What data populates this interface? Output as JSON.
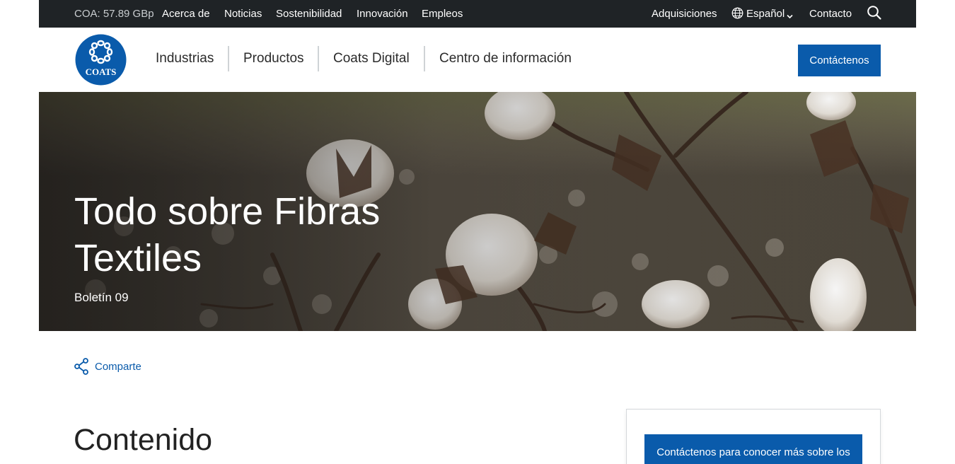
{
  "topbar": {
    "ticker": "COA: 57.89 GBp",
    "links": [
      "Acerca de",
      "Noticias",
      "Sostenibilidad",
      "Innovación",
      "Empleos"
    ],
    "right": {
      "acquisitions": "Adquisiciones",
      "language": "Español",
      "contact": "Contacto"
    }
  },
  "logo": {
    "text": "COATS"
  },
  "nav": {
    "items": [
      "Industrias",
      "Productos",
      "Coats Digital",
      "Centro de información"
    ],
    "cta": "Contáctenos"
  },
  "hero": {
    "title": "Todo sobre Fibras Textiles",
    "subtitle": "Boletín 09"
  },
  "share": {
    "label": "Comparte"
  },
  "content": {
    "heading": "Contenido"
  },
  "sidebar": {
    "button": "Contáctenos para conocer más sobre los hilos de Coats Coats"
  },
  "colors": {
    "brand": "#0a5bab",
    "topbar": "#1f2326"
  }
}
